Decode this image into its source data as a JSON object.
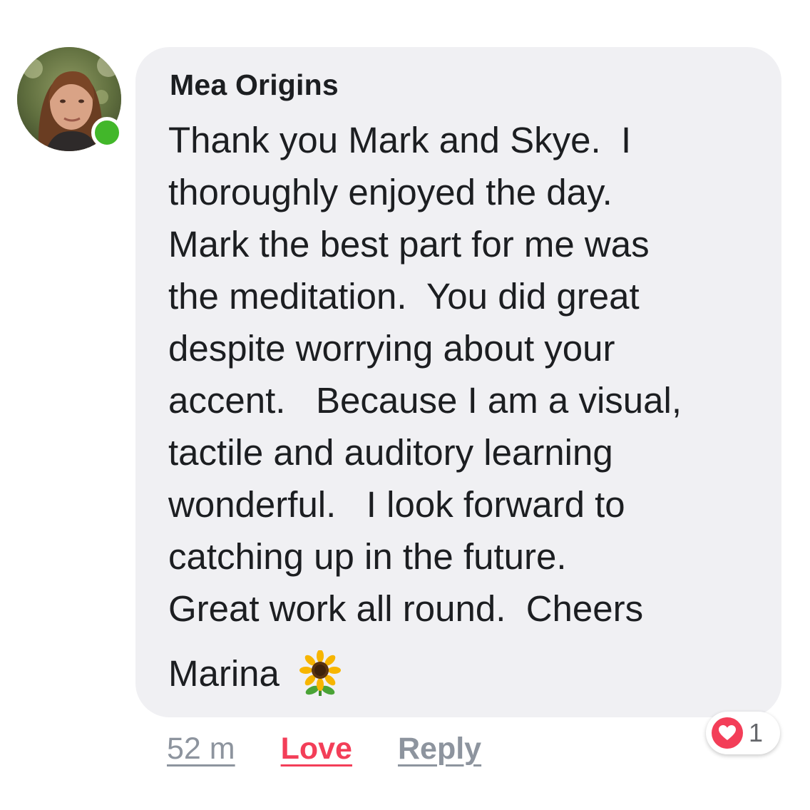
{
  "comment": {
    "author": "Mea Origins",
    "body_lines": [
      "Thank you Mark and Skye.  I",
      "thoroughly enjoyed the day.",
      "Mark the best part for me was",
      "the meditation.  You did great",
      "despite worrying about your",
      "accent.   Because I am a visual,",
      "tactile and auditory learning",
      "wonderful.   I look forward to",
      "catching up in the future.",
      "Great work all round.  Cheers"
    ],
    "signature": "Marina",
    "signature_icon": "sunflower-icon",
    "online_status": "online"
  },
  "actions": {
    "time": "52 m",
    "love": "Love",
    "reply": "Reply"
  },
  "reactions": {
    "type": "love-reaction-icon",
    "count": "1"
  },
  "colors": {
    "bubble": "#f0f0f3",
    "text": "#1c1e21",
    "love": "#f33e58",
    "muted": "#8d949e",
    "online": "#42b72a"
  }
}
